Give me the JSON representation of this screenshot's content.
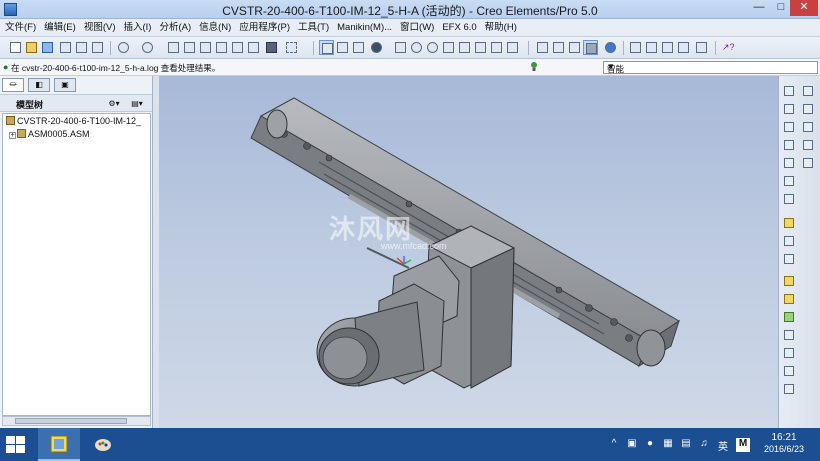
{
  "window": {
    "title": "CVSTR-20-400-6-T100-IM-12_5-H-A (活动的) - Creo Elements/Pro 5.0",
    "controls": [
      "minimize-icon",
      "maximize-icon",
      "close-icon"
    ]
  },
  "menu": [
    "文件(F)",
    "编辑(E)",
    "视图(V)",
    "插入(I)",
    "分析(A)",
    "信息(N)",
    "应用程序(P)",
    "工具(T)",
    "Manikin(M)...",
    "窗口(W)",
    "EFX 6.0",
    "帮助(H)"
  ],
  "message": {
    "text": "在 cvstr-20-400-6-t100-im-12_5-h-a.log 查看处理结果。"
  },
  "filter": {
    "value": "智能"
  },
  "model_tree": {
    "header": "模型树",
    "nodes": [
      {
        "label": "CVSTR-20-400-6-T100-IM-12_",
        "level": 0
      },
      {
        "label": "ASM0005.ASM",
        "level": 1,
        "expand": "+"
      }
    ]
  },
  "viewport": {
    "watermark": "沐风网",
    "watermark_url": "www.mfcad.com"
  },
  "taskbar": {
    "tray": [
      "^",
      "英",
      "M"
    ],
    "time": "16:21",
    "date": "2016/6/23"
  },
  "colors": {
    "titlebar": "#c9dcf4",
    "viewport_top": "#a7b9d8",
    "viewport_bottom": "#cfd8e7",
    "taskbar": "#1c4f91",
    "model_gray": "#8c8f94"
  }
}
